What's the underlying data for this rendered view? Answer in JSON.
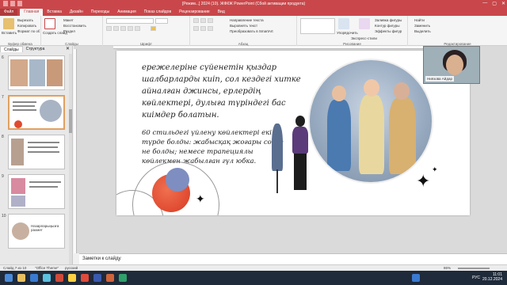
{
  "window": {
    "title": "[Режим...] 2024 (10).  ЖФКЖ  PowerPoint  (Сбой активации продукта)",
    "minimize": "—",
    "maximize": "▢",
    "close": "✕"
  },
  "tabs": [
    "Файл",
    "Главная",
    "Вставка",
    "Дизайн",
    "Переходы",
    "Анимация",
    "Показ слайдов",
    "Рецензирование",
    "Вид"
  ],
  "ribbon": {
    "clipboard": {
      "paste": "Вставить",
      "cut": "Вырезать",
      "copy": "Копировать",
      "format": "Формат по образцу",
      "label": "Буфер обмена"
    },
    "slides": {
      "new": "Создать слайд",
      "layout": "Макет",
      "reset": "Восстановить",
      "section": "Раздел",
      "label": "Слайды"
    },
    "font": {
      "label": "Шрифт"
    },
    "paragraph": {
      "direction": "Направление текста",
      "align": "Выровнять текст",
      "smartart": "Преобразовать в SmartArt",
      "label": "Абзац"
    },
    "drawing": {
      "arrange": "Упорядочить",
      "styles": "Экспресс-стили",
      "fill": "Заливка фигуры",
      "outline": "Контур фигуры",
      "effects": "Эффекты фигур",
      "label": "Рисование"
    },
    "editing": {
      "find": "Найти",
      "replace": "Заменить",
      "select": "Выделить",
      "label": "Редактирование"
    }
  },
  "leftpane": {
    "tab_slides": "Слайды",
    "tab_outline": "Структура",
    "close": "✕",
    "thumb_numbers": [
      "6",
      "7",
      "8",
      "9",
      "10"
    ],
    "slide10_text": "Назарларыңызға рахмет"
  },
  "slide": {
    "paragraph1": "ережелеріне сүйенетін қыздар шалбарларды киіп, сол кездегі хитке айналған джинсы, ерлердің көйлектері, дулыға түріндегі бас киімдер болатын.",
    "paragraph2": "60 стильдегі үйлену көйлектері екі ен түрде болды: жабысқақ жоғары сонге не болды; немесе трапециялы көйлекмен жабылған гүл юбка."
  },
  "webcam": {
    "name": "Ниязова Айдар"
  },
  "notes": {
    "placeholder": "Заметки к слайду"
  },
  "status": {
    "slide": "Слайд 7 из 10",
    "theme": "\"Office Theme\"",
    "lang": "русский",
    "zoom": "86%"
  },
  "taskbar": {
    "lang": "РУС",
    "time": "11:01",
    "date": "20.12.2024"
  },
  "colors": {
    "accent": "#c9474a",
    "slide_bg": "#ffffff",
    "deco": "#e04a30"
  }
}
